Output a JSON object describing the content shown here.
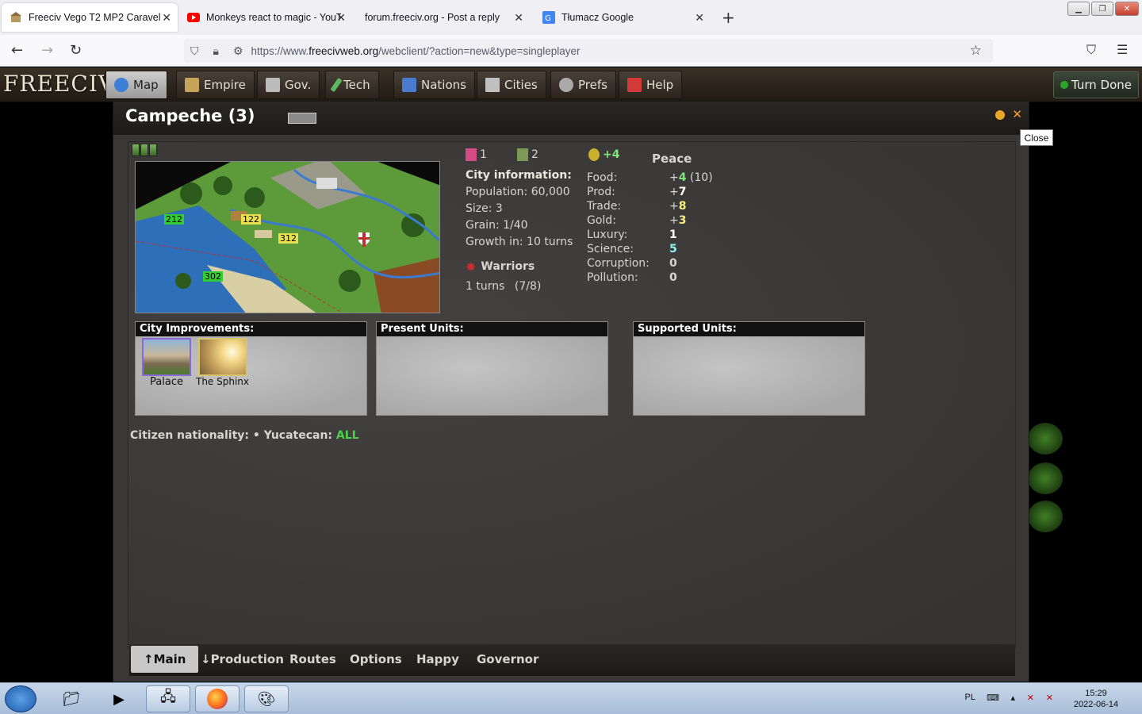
{
  "browser": {
    "tabs": [
      {
        "title": "Freeciv Vego T2 MP2 Caravel",
        "active": true
      },
      {
        "title": "Monkeys react to magic - YouT",
        "active": false
      },
      {
        "title": "forum.freeciv.org - Post a reply",
        "active": false
      },
      {
        "title": "Tłumacz Google",
        "active": false
      }
    ],
    "url_prefix": "https://www.",
    "url_domain": "freecivweb.org",
    "url_path": "/webclient/?action=new&type=singleplayer"
  },
  "game": {
    "logo": "FREECIV",
    "menu": [
      {
        "label": "Map",
        "icon": "globe-icon",
        "color": "#3d7fd6"
      },
      {
        "label": "Empire",
        "icon": "scales-icon",
        "color": "#c8a45a"
      },
      {
        "label": "Gov.",
        "icon": "building-icon",
        "color": "#bbbbbb"
      },
      {
        "label": "Tech",
        "icon": "pencil-icon",
        "color": "#5db85d"
      },
      {
        "label": "Nations",
        "icon": "un-icon",
        "color": "#4a7bd1"
      },
      {
        "label": "Cities",
        "icon": "city-icon",
        "color": "#c0c0c0"
      },
      {
        "label": "Prefs",
        "icon": "gear-icon",
        "color": "#aaaaaa"
      },
      {
        "label": "Help",
        "icon": "book-icon",
        "color": "#d23a3a"
      }
    ],
    "turn_done": "Turn Done"
  },
  "city": {
    "title": "Campeche (3)",
    "close_tooltip": "Close",
    "content_citizens": "1",
    "unhappy_citizens": "2",
    "surplus": "+4",
    "status": "Peace",
    "info_header": "City information:",
    "population": "Population: 60,000",
    "size": "Size: 3",
    "grain": "Grain: 1/40",
    "growth": "Growth in: 10 turns",
    "production_unit": "Warriors",
    "production_turns": "1 turns",
    "production_progress": "(7/8)",
    "stats": [
      {
        "label": "Food:",
        "sign": "+",
        "value": "4",
        "extra": " (10)",
        "color": "#7ee87e"
      },
      {
        "label": "Prod:",
        "sign": "+",
        "value": "7",
        "extra": "",
        "color": "#ffffff"
      },
      {
        "label": "Trade:",
        "sign": "+",
        "value": "8",
        "extra": "",
        "color": "#f7ef7e"
      },
      {
        "label": "Gold:",
        "sign": "+",
        "value": "3",
        "extra": "",
        "color": "#f7ef7e"
      },
      {
        "label": "Luxury:",
        "sign": "",
        "value": "1",
        "extra": "",
        "color": "#ffffff"
      },
      {
        "label": "Science:",
        "sign": "",
        "value": "5",
        "extra": "",
        "color": "#8ef2f2"
      },
      {
        "label": "Corruption:",
        "sign": "",
        "value": "0",
        "extra": "",
        "color": "#d7d5cf"
      },
      {
        "label": "Pollution:",
        "sign": "",
        "value": "0",
        "extra": "",
        "color": "#d7d5cf"
      }
    ],
    "map_tiles": [
      "212",
      "122",
      "312",
      "302"
    ],
    "panels": {
      "improvements": "City Improvements:",
      "present": "Present Units:",
      "supported": "Supported Units:"
    },
    "improvements": [
      {
        "name": "Palace"
      },
      {
        "name": "The Sphinx"
      }
    ],
    "nationality_prefix": "Citizen nationality: • Yucatecan: ",
    "nationality_value": "ALL",
    "tabs": [
      {
        "label": "↑Main",
        "active": true
      },
      {
        "label": "↓Production",
        "active": false
      },
      {
        "label": "Routes",
        "active": false
      },
      {
        "label": "Options",
        "active": false
      },
      {
        "label": "Happy",
        "active": false
      },
      {
        "label": "Governor",
        "active": false
      }
    ]
  },
  "taskbar": {
    "lang": "PL",
    "time": "15:29",
    "date": "2022-06-14"
  }
}
